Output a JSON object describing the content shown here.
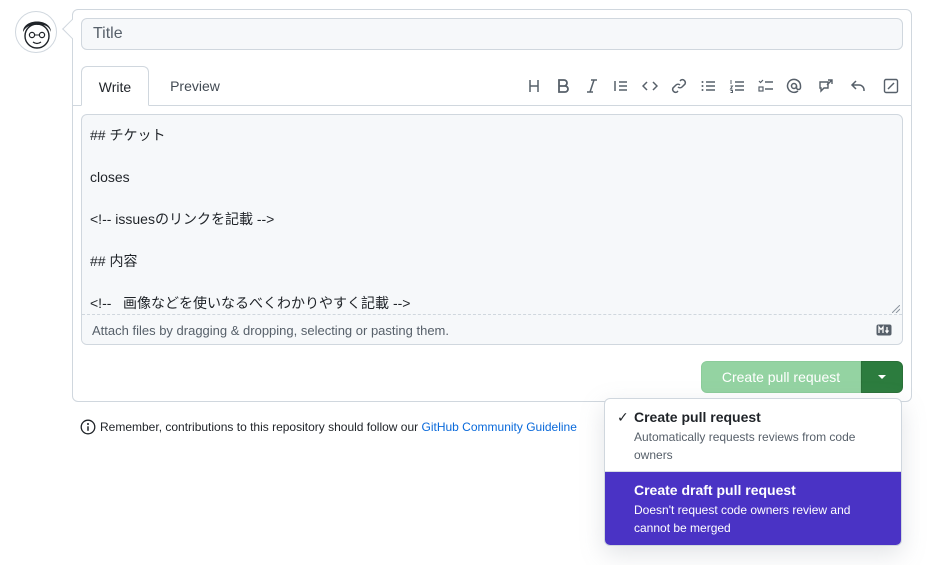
{
  "title_input": {
    "placeholder": "Title"
  },
  "tabs": {
    "write": "Write",
    "preview": "Preview"
  },
  "toolbar": {
    "icons": [
      "heading-icon",
      "bold-icon",
      "italic-icon",
      "quote-icon",
      "code-icon",
      "link-icon",
      "bulleted-list-icon",
      "numbered-list-icon",
      "task-list-icon",
      "mention-icon",
      "cross-reference-icon",
      "reply-icon",
      "slash-commands-icon"
    ]
  },
  "editor": {
    "body": "## チケット\n\ncloses\n\n<!-- issuesのリンクを記載 -->\n\n## 内容\n\n<!--   画像などを使いなるべくわかりやすく記載 -->",
    "attach_hint": "Attach files by dragging & dropping, selecting or pasting them.",
    "markdown_icon": "markdown-icon"
  },
  "actions": {
    "create_pr": "Create pull request"
  },
  "note": {
    "text": "Remember, contributions to this repository should follow our ",
    "link": "GitHub Community Guideline"
  },
  "dropdown": {
    "options": [
      {
        "title": "Create pull request",
        "description": "Automatically requests reviews from code owners",
        "selected": true
      },
      {
        "title": "Create draft pull request",
        "description": "Doesn't request code owners review and cannot be merged",
        "selected": false
      }
    ]
  },
  "colors": {
    "primary_disabled": "#94d3a2",
    "primary": "#2c7c3e",
    "highlight": "#4a33c5",
    "link": "#0969da"
  }
}
